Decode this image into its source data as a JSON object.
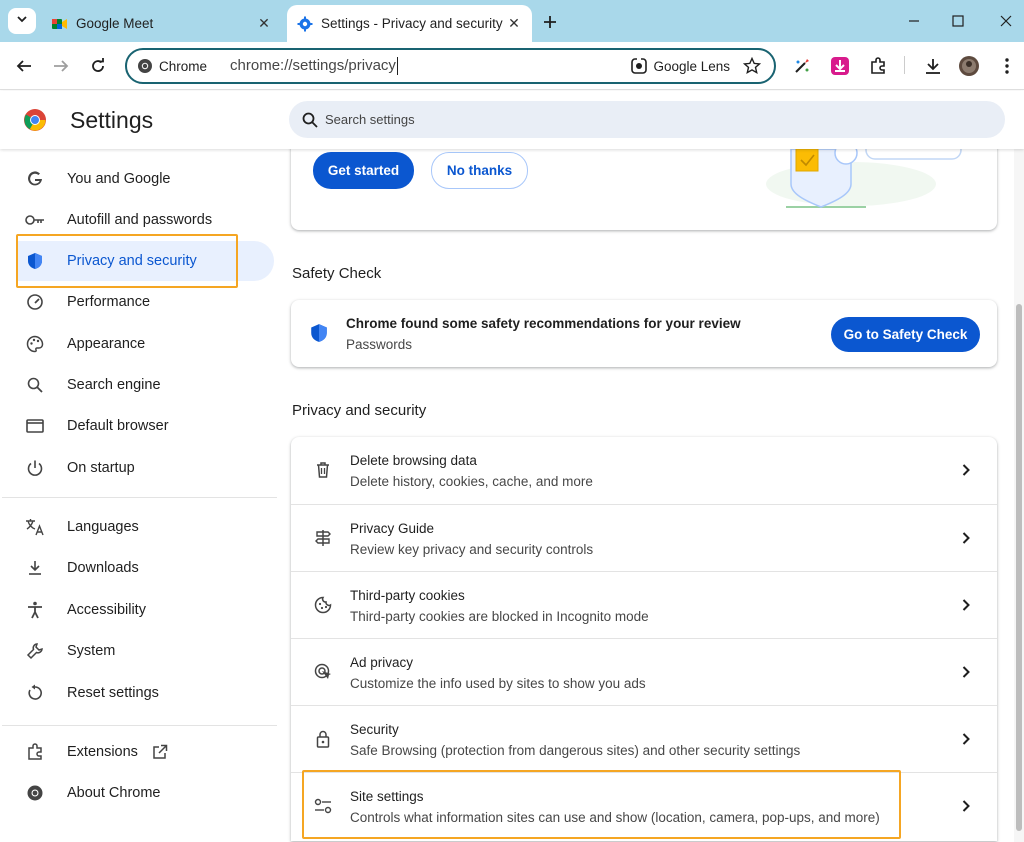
{
  "tabs": [
    {
      "title": "Google Meet",
      "favicon": "google-meet-icon",
      "active": false
    },
    {
      "title": "Settings - Privacy and security",
      "favicon": "gear-icon",
      "active": true
    }
  ],
  "omnibox": {
    "chip_label": "Chrome",
    "url": "chrome://settings/privacy",
    "lens_label": "Google Lens"
  },
  "header": {
    "title": "Settings",
    "search_placeholder": "Search settings"
  },
  "sidebar": {
    "items": [
      {
        "label": "You and Google",
        "icon": "google-g-icon"
      },
      {
        "label": "Autofill and passwords",
        "icon": "key-icon"
      },
      {
        "label": "Privacy and security",
        "icon": "shield-icon",
        "selected": true
      },
      {
        "label": "Performance",
        "icon": "speedometer-icon"
      },
      {
        "label": "Appearance",
        "icon": "palette-icon"
      },
      {
        "label": "Search engine",
        "icon": "search-icon"
      },
      {
        "label": "Default browser",
        "icon": "browser-window-icon"
      },
      {
        "label": "On startup",
        "icon": "power-icon"
      },
      {
        "label": "Languages",
        "icon": "translate-icon"
      },
      {
        "label": "Downloads",
        "icon": "download-icon"
      },
      {
        "label": "Accessibility",
        "icon": "accessibility-icon"
      },
      {
        "label": "System",
        "icon": "wrench-icon"
      },
      {
        "label": "Reset settings",
        "icon": "reset-icon"
      },
      {
        "label": "Extensions",
        "icon": "puzzle-icon"
      },
      {
        "label": "About Chrome",
        "icon": "chrome-icon"
      }
    ]
  },
  "guide_card": {
    "get_started_label": "Get started",
    "no_thanks_label": "No thanks"
  },
  "safety_check": {
    "section_title": "Safety Check",
    "message": "Chrome found some safety recommendations for your review",
    "subtext": "Passwords",
    "button_label": "Go to Safety Check"
  },
  "privacy": {
    "section_title": "Privacy and security",
    "rows": [
      {
        "title": "Delete browsing data",
        "subtitle": "Delete history, cookies, cache, and more",
        "icon": "trash-icon"
      },
      {
        "title": "Privacy Guide",
        "subtitle": "Review key privacy and security controls",
        "icon": "signpost-icon"
      },
      {
        "title": "Third-party cookies",
        "subtitle": "Third-party cookies are blocked in Incognito mode",
        "icon": "cookie-icon"
      },
      {
        "title": "Ad privacy",
        "subtitle": "Customize the info used by sites to show you ads",
        "icon": "ad-target-icon"
      },
      {
        "title": "Security",
        "subtitle": "Safe Browsing (protection from dangerous sites) and other security settings",
        "icon": "lock-icon"
      },
      {
        "title": "Site settings",
        "subtitle": "Controls what information sites can use and show (location, camera, pop-ups, and more)",
        "icon": "sliders-icon"
      }
    ]
  },
  "colors": {
    "accent": "#0b57d0",
    "tabstrip": "#a9d8ea",
    "highlight": "#f5a623",
    "selected_bg": "#e8f0fe"
  }
}
